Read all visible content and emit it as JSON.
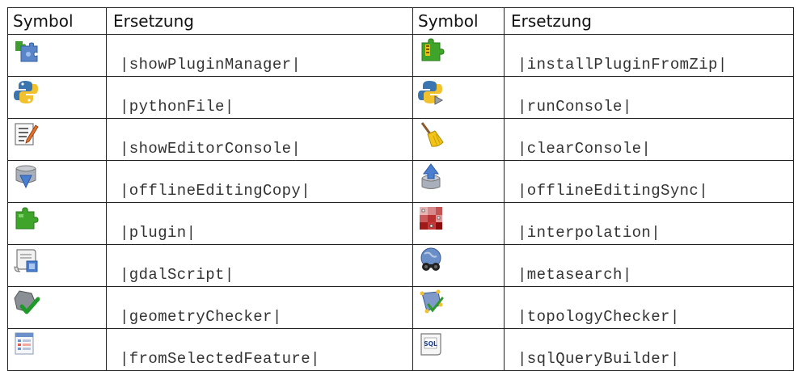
{
  "table": {
    "headers": [
      "Symbol",
      "Ersetzung",
      "Symbol",
      "Ersetzung"
    ],
    "rows": [
      {
        "left_icon": "plugin-manager-icon",
        "left_sub": "|showPluginManager|",
        "right_icon": "install-plugin-zip-icon",
        "right_sub": "|installPluginFromZip|"
      },
      {
        "left_icon": "python-file-icon",
        "left_sub": "|pythonFile|",
        "right_icon": "run-console-icon",
        "right_sub": "|runConsole|"
      },
      {
        "left_icon": "editor-console-icon",
        "left_sub": "|showEditorConsole|",
        "right_icon": "broom-icon",
        "right_sub": "|clearConsole|"
      },
      {
        "left_icon": "offline-editing-copy-icon",
        "left_sub": "|offlineEditingCopy|",
        "right_icon": "offline-editing-sync-icon",
        "right_sub": "|offlineEditingSync|"
      },
      {
        "left_icon": "plugin-icon",
        "left_sub": "|plugin|",
        "right_icon": "interpolation-icon",
        "right_sub": "|interpolation|"
      },
      {
        "left_icon": "gdal-script-icon",
        "left_sub": "|gdalScript|",
        "right_icon": "metasearch-icon",
        "right_sub": "|metasearch|"
      },
      {
        "left_icon": "geometry-checker-icon",
        "left_sub": "|geometryChecker|",
        "right_icon": "topology-checker-icon",
        "right_sub": "|topologyChecker|"
      },
      {
        "left_icon": "from-selected-feature-icon",
        "left_sub": "|fromSelectedFeature|",
        "right_icon": "sql-query-builder-icon",
        "right_sub": "|sqlQueryBuilder|"
      }
    ]
  }
}
